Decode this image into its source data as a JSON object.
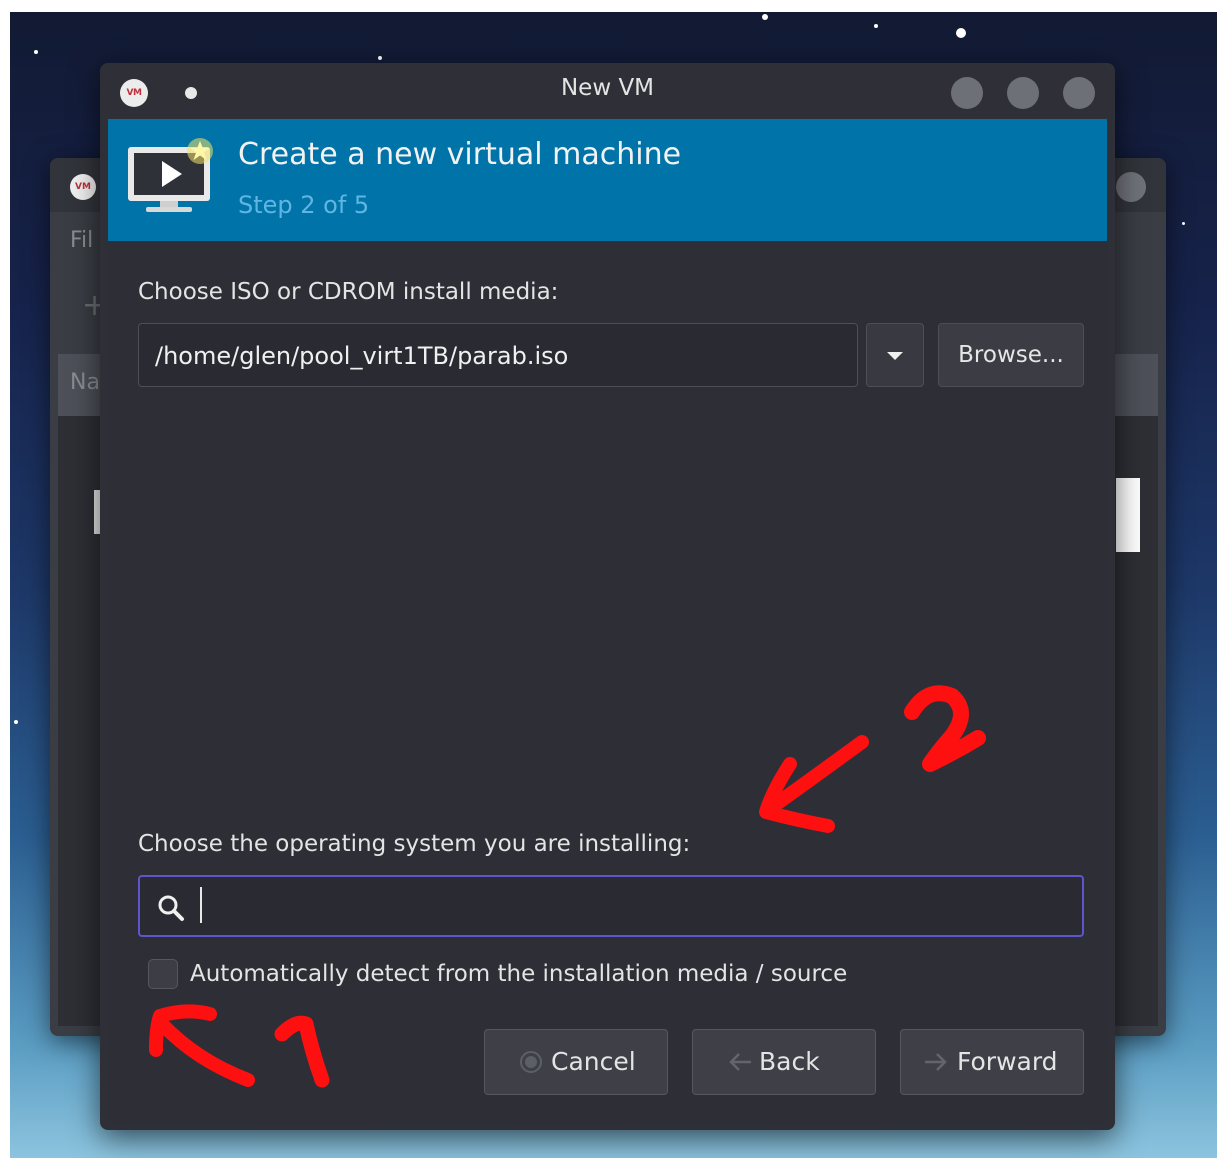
{
  "dialog": {
    "window_title": "New VM",
    "logo_text": "VM",
    "banner": {
      "title": "Create a new virtual machine",
      "step": "Step 2 of 5"
    },
    "install_media": {
      "label": "Choose ISO or CDROM install media:",
      "value": "/home/glen/pool_virt1TB/parab.iso",
      "browse_label": "Browse..."
    },
    "os": {
      "label": "Choose the operating system you are installing:",
      "search_value": "",
      "auto_detect_label": "Automatically detect from the installation media / source",
      "auto_detect_checked": false
    },
    "footer": {
      "cancel_label": "Cancel",
      "back_label": "Back",
      "forward_label": "Forward"
    }
  },
  "background_window": {
    "menu_partial": "Fil",
    "column_partial": "Na"
  },
  "colors": {
    "banner": "#0073a8",
    "step_text": "#5fb6e3",
    "focus_border": "#5e55cc",
    "dialog_bg": "#2e2f37",
    "annotation": "#ff1010"
  },
  "annotations": [
    {
      "label": "1"
    },
    {
      "label": "2"
    }
  ]
}
